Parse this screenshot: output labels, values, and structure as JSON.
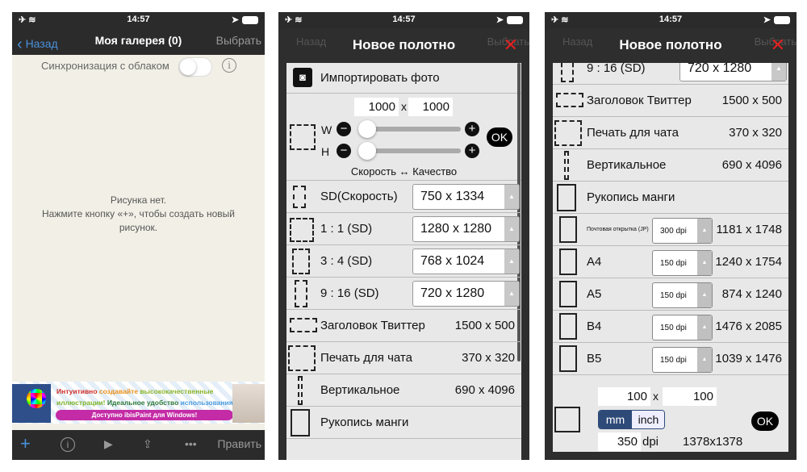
{
  "status": {
    "time": "14:57"
  },
  "gallery": {
    "back": "Назад",
    "title": "Моя галерея (0)",
    "select": "Выбрать",
    "sync_label": "Синхронизация с облаком",
    "sync_on": false,
    "empty_line1": "Рисунка нет.",
    "empty_line2": "Нажмите кнопку «+», чтобы создать новый рисунок.",
    "ad": {
      "line1": [
        "Интуитивно ",
        "создавайте ",
        "высококачественные"
      ],
      "line2": [
        "иллюстрации! ",
        "Идеальное удобство ",
        "использования!"
      ],
      "button": "Доступно ibisPaint для Windows!",
      "logo": "iP"
    },
    "toolbar": {
      "edit": "Править"
    }
  },
  "dialog": {
    "title": "Новое полотно",
    "import": "Импортировать фото",
    "width": "1000",
    "height": "1000",
    "x": "x",
    "w_label": "W",
    "h_label": "H",
    "ok": "OK",
    "speed_quality": "Скорость ↔ Качество",
    "presets_a": [
      {
        "label": "SD(Скорость)",
        "size": "750 x 1334"
      },
      {
        "label": "1 : 1 (SD)",
        "size": "1280 x 1280"
      },
      {
        "label": "3 : 4 (SD)",
        "size": "768 x 1024"
      },
      {
        "label": "9 : 16 (SD)",
        "size": "720 x 1280"
      }
    ],
    "presets_b": [
      {
        "label": "Заголовок Твиттер",
        "size": "1500 x 500"
      },
      {
        "label": "Печать для чата",
        "size": "370 x 320"
      },
      {
        "label": "Вертикальное",
        "size": "690 x 4096"
      },
      {
        "label": "Рукопись манги",
        "size": ""
      }
    ],
    "paper": [
      {
        "label": "Почтовая открытка (JP)",
        "dpi": "300 dpi",
        "size": "1181 x 1748"
      },
      {
        "label": "A4",
        "dpi": "150 dpi",
        "size": "1240 x 1754"
      },
      {
        "label": "A5",
        "dpi": "150 dpi",
        "size": "874 x 1240"
      },
      {
        "label": "B4",
        "dpi": "150 dpi",
        "size": "1476 x 2085"
      },
      {
        "label": "B5",
        "dpi": "150 dpi",
        "size": "1039 x 1476"
      }
    ],
    "custom": {
      "w": "100",
      "h": "100",
      "unit_mm": "mm",
      "unit_inch": "inch",
      "dpi": "350",
      "dpi_suffix": "dpi",
      "result": "1378x1378"
    }
  },
  "colors": {
    "accent": "#4a90d9",
    "close": "#e02020",
    "unit_selected": "#2e4a78"
  }
}
